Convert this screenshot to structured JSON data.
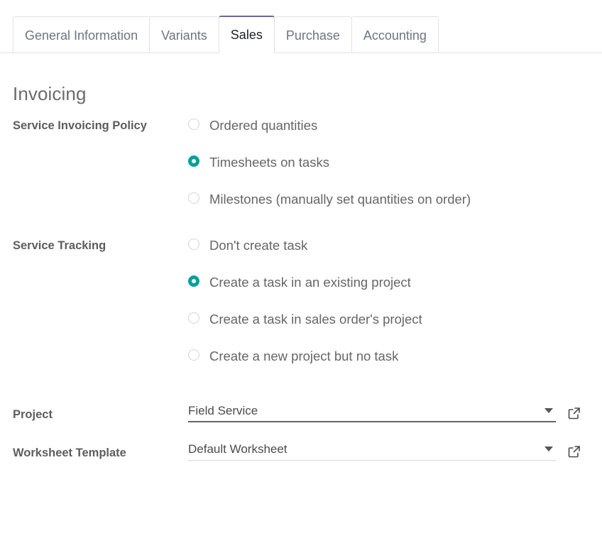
{
  "tabs": [
    {
      "label": "General Information",
      "active": false
    },
    {
      "label": "Variants",
      "active": false
    },
    {
      "label": "Sales",
      "active": true
    },
    {
      "label": "Purchase",
      "active": false
    },
    {
      "label": "Accounting",
      "active": false
    }
  ],
  "section": {
    "title": "Invoicing"
  },
  "invoicing_policy": {
    "label": "Service Invoicing Policy",
    "options": [
      {
        "label": "Ordered quantities",
        "checked": false
      },
      {
        "label": "Timesheets on tasks",
        "checked": true
      },
      {
        "label": "Milestones (manually set quantities on order)",
        "checked": false
      }
    ]
  },
  "service_tracking": {
    "label": "Service Tracking",
    "options": [
      {
        "label": "Don't create task",
        "checked": false
      },
      {
        "label": "Create a task in an existing project",
        "checked": true
      },
      {
        "label": "Create a task in sales order's project",
        "checked": false
      },
      {
        "label": "Create a new project but no task",
        "checked": false
      }
    ]
  },
  "project_field": {
    "label": "Project",
    "value": "Field Service",
    "placeholder": "",
    "focused": true,
    "caret_icon": "chevron-down-icon",
    "external_icon": "external-link-icon"
  },
  "worksheet_field": {
    "label": "Worksheet Template",
    "value": "Default Worksheet",
    "placeholder": "",
    "focused": false,
    "caret_icon": "chevron-down-icon",
    "external_icon": "external-link-icon"
  },
  "colors": {
    "accent_teal": "#00a09d",
    "active_tab_border": "#71639e",
    "tab_border": "#dee2e6",
    "label_text": "#5d5d5d",
    "body_text": "#666666",
    "field_underline": "#d8d8d8",
    "field_underline_focused": "#666666"
  }
}
